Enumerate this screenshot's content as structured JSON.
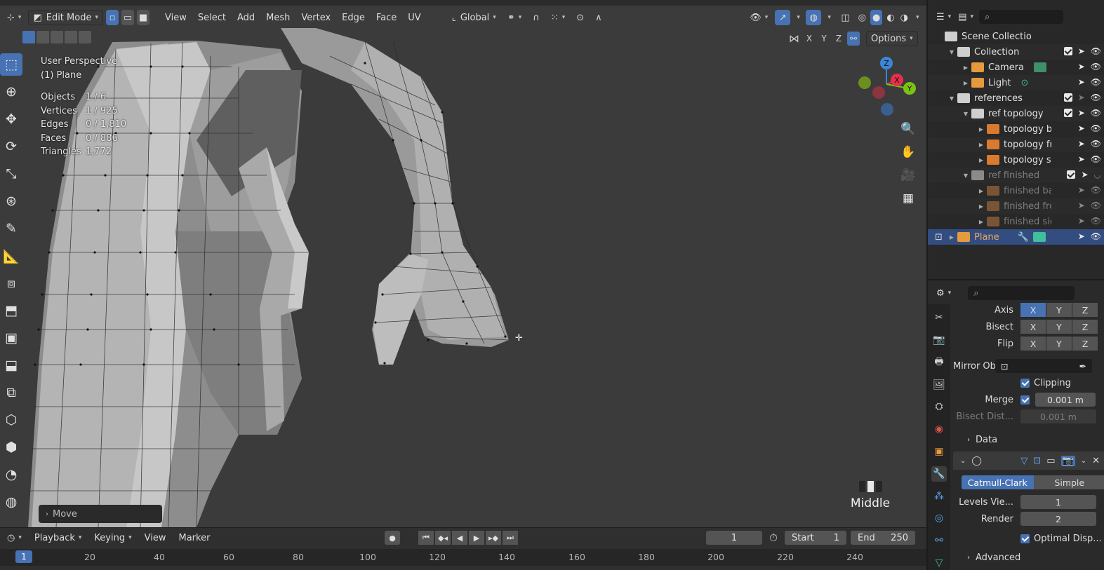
{
  "viewport": {
    "header": {
      "mode": "Edit Mode",
      "menus": [
        "View",
        "Select",
        "Add",
        "Mesh",
        "Vertex",
        "Edge",
        "Face",
        "UV"
      ],
      "transform_orientation": "Global",
      "options_label": "Options",
      "axis_labels": [
        "X",
        "Y",
        "Z"
      ]
    },
    "info": {
      "view_name": "User Perspective",
      "object_name": "(1) Plane"
    },
    "stats": [
      {
        "label": "Objects",
        "value": "1 / 6"
      },
      {
        "label": "Vertices",
        "value": "1 / 925"
      },
      {
        "label": "Edges",
        "value": "0 / 1,810"
      },
      {
        "label": "Faces",
        "value": "0 / 886"
      },
      {
        "label": "Triangles",
        "value": "1,772"
      }
    ],
    "gizmo": {
      "x": "X",
      "y": "Y",
      "z": "Z"
    },
    "operator_panel": "Move",
    "mouse_indicator": "Middle",
    "colors": {
      "accent": "#4772b3",
      "x_axis": "#e6304b",
      "y_axis": "#7cc215",
      "z_axis": "#3c86d9"
    }
  },
  "timeline": {
    "menus": [
      "Playback",
      "Keying",
      "View",
      "Marker"
    ],
    "current_frame": "1",
    "start_label": "Start",
    "start_value": "1",
    "end_label": "End",
    "end_value": "250",
    "cursor_frame": "1",
    "ruler_ticks": [
      "20",
      "40",
      "60",
      "80",
      "100",
      "120",
      "140",
      "160",
      "180",
      "200",
      "220",
      "240"
    ]
  },
  "outliner": {
    "items": [
      {
        "name": "Scene Collection",
        "icon": "scene-collection-icon"
      },
      {
        "name": "Collection",
        "icon": "collection-icon"
      },
      {
        "name": "Camera",
        "icon": "camera-icon"
      },
      {
        "name": "Light",
        "icon": "light-icon"
      },
      {
        "name": "references",
        "icon": "collection-icon"
      },
      {
        "name": "ref topology",
        "icon": "collection-icon"
      },
      {
        "name": "topology ba",
        "icon": "image-empty-icon"
      },
      {
        "name": "topology fro",
        "icon": "image-empty-icon"
      },
      {
        "name": "topology sid",
        "icon": "image-empty-icon"
      },
      {
        "name": "ref finished",
        "icon": "collection-icon"
      },
      {
        "name": "finished ba",
        "icon": "image-empty-icon"
      },
      {
        "name": "finished fro",
        "icon": "image-empty-icon"
      },
      {
        "name": "finished sid",
        "icon": "image-empty-icon"
      },
      {
        "name": "Plane",
        "icon": "mesh-icon"
      }
    ]
  },
  "properties": {
    "mirror": {
      "axis_label": "Axis",
      "bisect_label": "Bisect",
      "flip_label": "Flip",
      "axes": [
        "X",
        "Y",
        "Z"
      ],
      "mirror_object_label": "Mirror Obje...",
      "clipping_label": "Clipping",
      "merge_label": "Merge",
      "merge_value": "0.001 m",
      "bisect_dist_label": "Bisect Dist...",
      "bisect_dist_value": "0.001 m",
      "data_label": "Data"
    },
    "subsurf": {
      "method_a": "Catmull-Clark",
      "method_b": "Simple",
      "levels_label": "Levels Vie...",
      "levels_value": "1",
      "render_label": "Render",
      "render_value": "2",
      "optimal_label": "Optimal Disp...",
      "advanced_label": "Advanced"
    }
  }
}
